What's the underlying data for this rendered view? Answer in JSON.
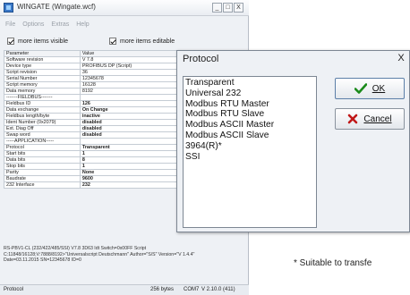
{
  "window": {
    "title": "WINGATE (Wingate.wcf)",
    "minimize": "_",
    "maximize": "□",
    "close": "X"
  },
  "menu": [
    "File",
    "Options",
    "Extras",
    "Help"
  ],
  "checkboxes": {
    "more_items_visible": "more items visible",
    "more_items_editable": "more items editable"
  },
  "table": {
    "headers": [
      "Parameter",
      "Value"
    ],
    "rows": [
      [
        "Software revision",
        "V 7.8",
        false
      ],
      [
        "Device type",
        "PROFIBUS DP (Script)",
        false
      ],
      [
        "Script revision",
        "36",
        false
      ],
      [
        "Serial Number",
        "12345678",
        false
      ],
      [
        "Script memory",
        "16128",
        false
      ],
      [
        "Data memory",
        "8192",
        false
      ],
      [
        "-------FIELDBUS-------",
        "",
        false
      ],
      [
        "Fieldbus ID",
        "126",
        true
      ],
      [
        "Data exchange",
        "On Change",
        true
      ],
      [
        "Fieldbus length/byte",
        "inactive",
        true
      ],
      [
        "Ident Number (0x2079)",
        "disabled",
        true
      ],
      [
        "Ext. Diag Off",
        "disabled",
        true
      ],
      [
        "Swap word",
        "disabled",
        true
      ],
      [
        "-----APPLICATION-----",
        "",
        false
      ],
      [
        "Protocol",
        "Transparent",
        true
      ],
      [
        "Start bits",
        "1",
        true
      ],
      [
        "Data bits",
        "8",
        true
      ],
      [
        "Stop bits",
        "1",
        true
      ],
      [
        "Parity",
        "None",
        true
      ],
      [
        "Baudrate",
        "9600",
        true
      ],
      [
        "232 Interface",
        "232",
        true
      ]
    ]
  },
  "info_lines": [
    "RS-PBV1-CL (232/422/485/SSI) V7.8 3D63 Idt Switch=0x00FF Script",
    "C:11848/16128;V:7888/8192>\"Universalscript Deutschmann\" Author=\"S/S\" Version=\"V 1.4.4\"",
    "Date=03.11.2015 SN=12345678 ID=0"
  ],
  "status": {
    "protocol": "Protocol",
    "bytes": "256 bytes",
    "port": "COM7",
    "version": "V 2.10.0 (411)"
  },
  "dialog": {
    "title": "Protocol",
    "close": "X",
    "items": [
      "Transparent",
      "Universal 232",
      "Modbus RTU Master",
      "Modbus RTU Slave",
      "Modbus ASCII Master",
      "Modbus ASCII Slave",
      "3964(R)*",
      "SSI"
    ],
    "ok_label": "OK",
    "cancel_label": "Cancel",
    "ok_icon": "check-icon",
    "cancel_icon": "x-icon"
  },
  "footnote": "* Suitable to transfe",
  "colors": {
    "accent": "#3a78c8",
    "ok_check": "#1a8a1a",
    "cancel_x": "#c01818"
  }
}
